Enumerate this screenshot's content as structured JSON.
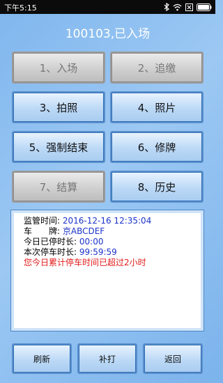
{
  "status_bar": {
    "time": "下午5:15"
  },
  "header": {
    "title": "100103,已入场"
  },
  "buttons": [
    {
      "label": "1、入场",
      "enabled": false
    },
    {
      "label": "2、追缴",
      "enabled": false
    },
    {
      "label": "3、拍照",
      "enabled": true
    },
    {
      "label": "4、照片",
      "enabled": true
    },
    {
      "label": "5、强制结束",
      "enabled": true
    },
    {
      "label": "6、修牌",
      "enabled": true
    },
    {
      "label": "7、结算",
      "enabled": false
    },
    {
      "label": "8、历史",
      "enabled": true
    }
  ],
  "info": {
    "supervise_time_label": "监管时间:",
    "supervise_time_value": "2016-12-16 12:35:04",
    "plate_label": "车　　牌:",
    "plate_value": "京ABCDEF",
    "today_duration_label": "今日已停时长:",
    "today_duration_value": "00:00",
    "current_duration_label": "本次停车时长:",
    "current_duration_value": "99:59:59",
    "warning": "您今日累计停车时间已超过2小时"
  },
  "bottom": {
    "refresh": "刷新",
    "reprint": "补打",
    "back": "返回"
  }
}
